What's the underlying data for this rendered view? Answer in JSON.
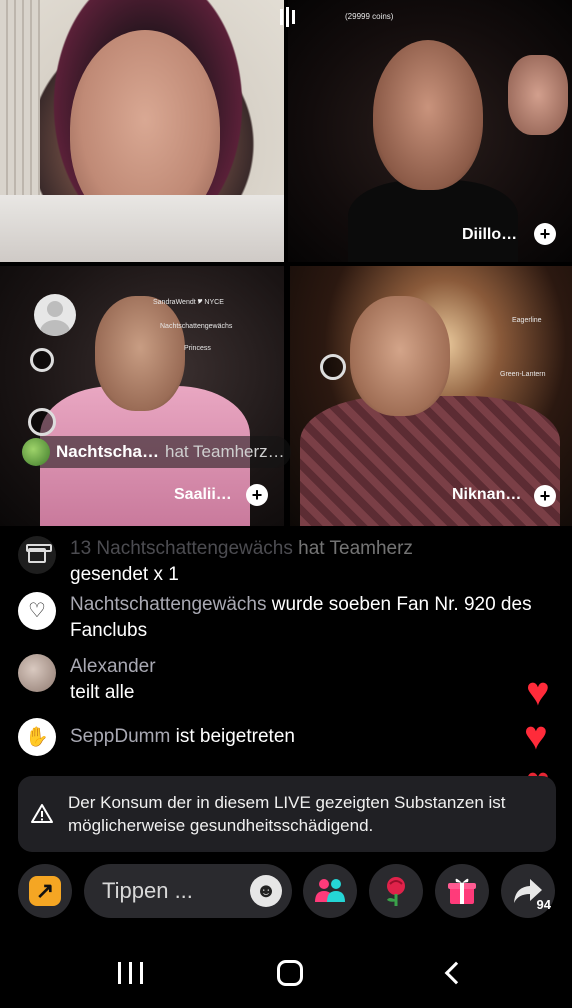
{
  "grid": {
    "tiles": [
      {
        "name": ""
      },
      {
        "name": "Diillo…",
        "coins_label": "(29999 coins)"
      },
      {
        "name": "Saalii…",
        "top_gifters": [
          "SandraWendt 🎔 NYCE",
          "Nachtschattengewächs",
          "Princess"
        ]
      },
      {
        "name": "Niknan…",
        "top_gifters": [
          "Eagerline",
          "Green-Lantern"
        ]
      }
    ],
    "gift_banner": {
      "user": "Nachtscha…",
      "action": "hat Teamherz…"
    }
  },
  "chat": {
    "messages": [
      {
        "kind": "gift",
        "icon": "box-icon",
        "user": "Nachtschattengewächs",
        "text_faded": "hat Teamherz",
        "text": "gesendet x 1",
        "count_badge": "13"
      },
      {
        "kind": "fan",
        "icon": "heart-icon",
        "user": "Nachtschattengewächs",
        "text": "wurde soeben Fan Nr. 920 des Fanclubs"
      },
      {
        "kind": "share",
        "icon": "user-avatar",
        "user": "Alexander",
        "text": "teilt alle"
      },
      {
        "kind": "join",
        "icon": "wave-icon",
        "user": "SeppDumm",
        "text": "ist beigetreten"
      }
    ]
  },
  "warning": {
    "text": "Der Konsum der in diesem LIVE gezeigten Substanzen ist möglicherweise gesundheitsschädigend."
  },
  "bottom_bar": {
    "input_placeholder": "Tippen ...",
    "share_count": "94"
  },
  "colors": {
    "heart": "#ff2b3a",
    "share_accent": "#f5a623",
    "warning_bg": "#202024",
    "pill_bg": "#2a2a2e"
  }
}
